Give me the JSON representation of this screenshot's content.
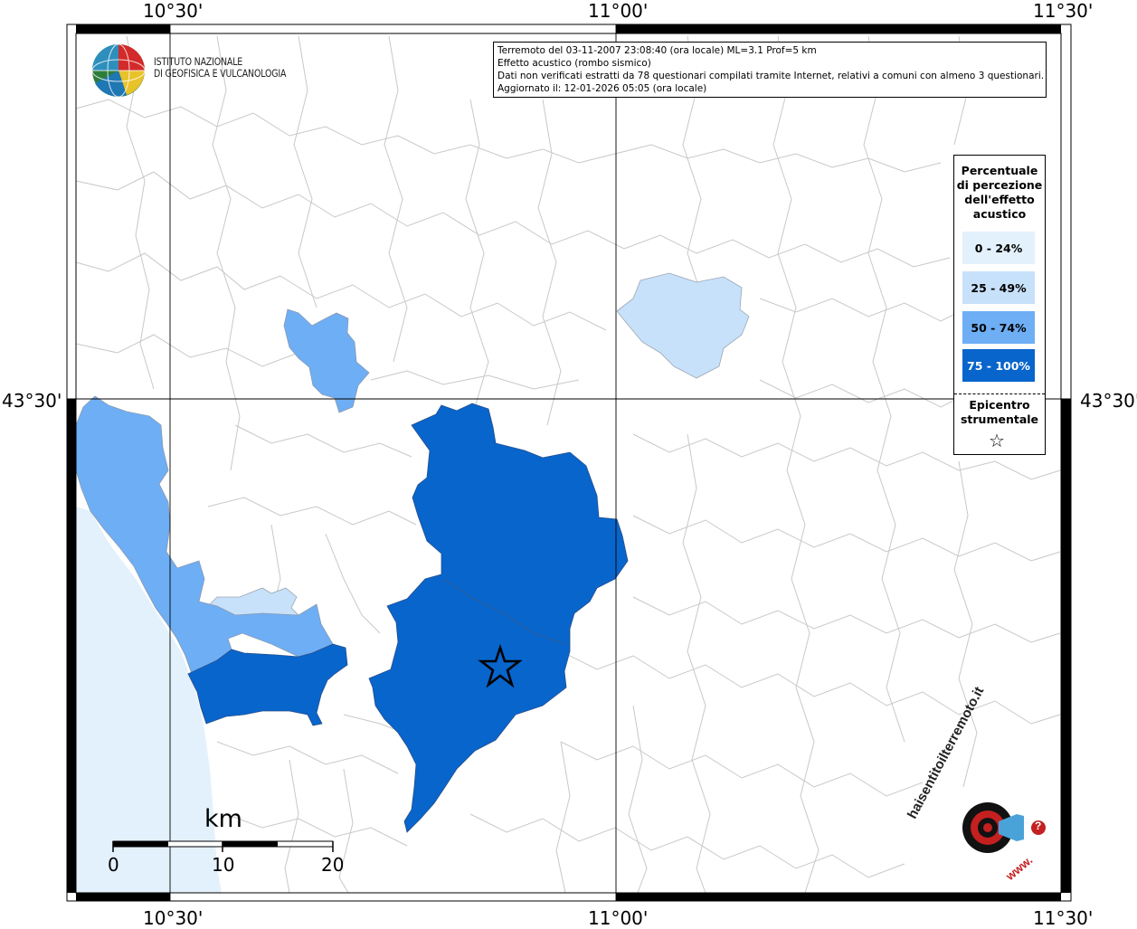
{
  "map": {
    "grid_labels": {
      "top": [
        "10°30'",
        "11°00'",
        "11°30'"
      ],
      "bottom": [
        "10°30'",
        "11°00'",
        "11°30'"
      ],
      "left": "43°30'",
      "right": "43°30'"
    },
    "sea_color": "#e3f1fc",
    "border_color": "#c8c8c8"
  },
  "logo": {
    "org_line1": "ISTITUTO NAZIONALE",
    "org_line2": "DI GEOFISICA E VULCANOLOGIA"
  },
  "info": {
    "line1": "Terremoto del 03-11-2007 23:08:40 (ora locale) ML=3.1 Prof=5 km",
    "line2": "Effetto acustico (rombo sismico)",
    "line3": "Dati non verificati estratti da 78 questionari compilati tramite Internet, relativi a comuni con almeno 3 questionari.",
    "line4": "Aggiornato il: 12-01-2026 05:05 (ora locale)"
  },
  "legend": {
    "title_lines": [
      "Percentuale",
      "di percezione",
      "dell'effetto",
      "acustico"
    ],
    "classes": [
      {
        "label": "0 - 24%",
        "color": "#e3f1fc"
      },
      {
        "label": "25 - 49%",
        "color": "#c8e1fa"
      },
      {
        "label": "50 - 74%",
        "color": "#6eaef5"
      },
      {
        "label": "75 - 100%",
        "color": "#0765cc"
      }
    ],
    "epicenter_lines": [
      "Epicentro",
      "strumentale"
    ],
    "epicenter_symbol": "☆"
  },
  "scale_bar": {
    "unit": "km",
    "ticks": [
      "0",
      "10",
      "20"
    ]
  },
  "watermark": {
    "text_ring": "haisentitoilterremoto.it",
    "text_sub": "www.",
    "badge": "?"
  }
}
